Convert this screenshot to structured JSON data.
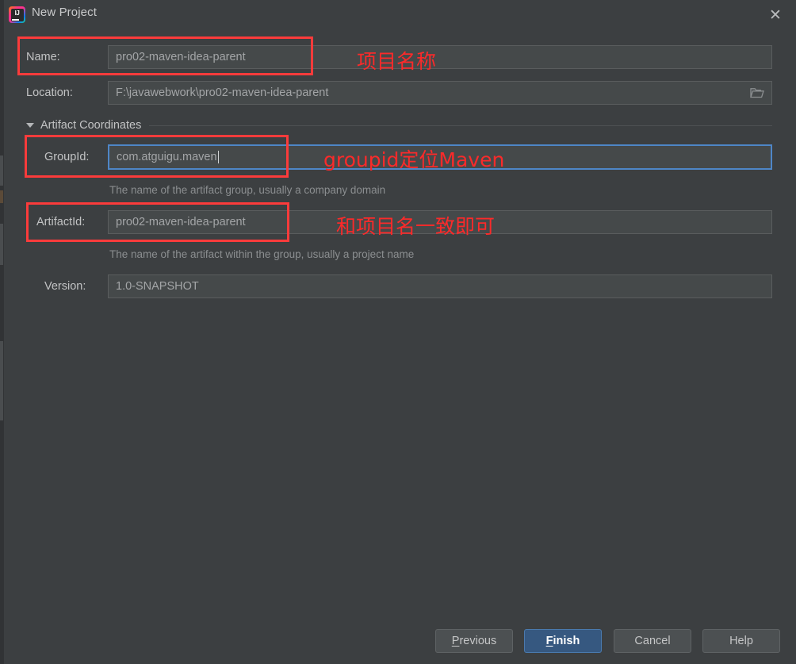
{
  "window": {
    "title": "New Project",
    "logo_icon": "intellij-idea-logo",
    "logo_text": "IJ",
    "close_icon": "close-icon"
  },
  "form": {
    "name": {
      "label": "Name:",
      "value": "pro02-maven-idea-parent"
    },
    "location": {
      "label": "Location:",
      "value": "F:\\javawebwork\\pro02-maven-idea-parent",
      "browse_icon": "folder-icon"
    },
    "section": {
      "title": "Artifact Coordinates",
      "collapse_icon": "triangle-down-icon"
    },
    "group_id": {
      "label": "GroupId:",
      "value": "com.atguigu.maven",
      "hint": "The name of the artifact group, usually a company domain",
      "focused": true
    },
    "artifact_id": {
      "label": "ArtifactId:",
      "value": "pro02-maven-idea-parent",
      "hint": "The name of the artifact within the group, usually a project name"
    },
    "version": {
      "label": "Version:",
      "value": "1.0-SNAPSHOT"
    }
  },
  "annotations": {
    "color": "#fb2a2a",
    "name_note": "项目名称",
    "group_note": "groupid定位Maven",
    "artifact_note": "和项目名一致即可"
  },
  "footer": {
    "previous": "Previous",
    "previous_mnemonic": "P",
    "previous_rest": "revious",
    "finish": "Finish",
    "finish_mnemonic": "F",
    "finish_rest": "inish",
    "cancel": "Cancel",
    "help": "Help"
  }
}
